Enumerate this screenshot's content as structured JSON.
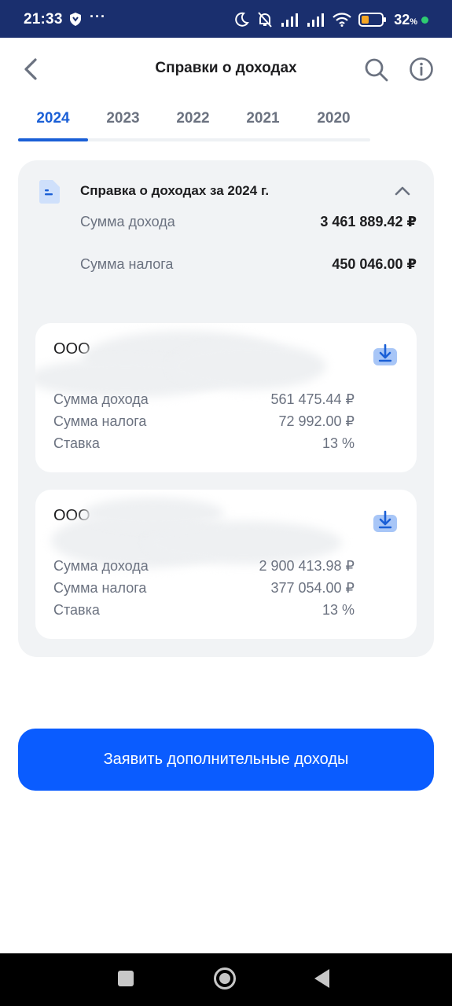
{
  "status_bar": {
    "time": "21:33",
    "dots": "···",
    "battery_percent": "32",
    "battery_unit": "%"
  },
  "header": {
    "title": "Справки о доходах",
    "back_icon": "chevron-left-icon",
    "search_icon": "search-icon",
    "info_icon": "info-icon"
  },
  "tabs": {
    "items": [
      {
        "label": "2024",
        "active": true
      },
      {
        "label": "2023",
        "active": false
      },
      {
        "label": "2022",
        "active": false
      },
      {
        "label": "2021",
        "active": false
      },
      {
        "label": "2020",
        "active": false
      }
    ]
  },
  "summary": {
    "title": "Справка о доходах за 2024 г.",
    "income_label": "Сумма дохода",
    "income_value": "3 461 889.42 ₽",
    "tax_label": "Сумма налога",
    "tax_value": "450 046.00 ₽"
  },
  "employers": [
    {
      "name": "ООО",
      "income_label": "Сумма дохода",
      "income_value": "561 475.44 ₽",
      "tax_label": "Сумма налога",
      "tax_value": "72 992.00 ₽",
      "rate_label": "Ставка",
      "rate_value": "13 %"
    },
    {
      "name": "ООО",
      "income_label": "Сумма дохода",
      "income_value": "2 900 413.98 ₽",
      "tax_label": "Сумма налога",
      "tax_value": "377 054.00 ₽",
      "rate_label": "Ставка",
      "rate_value": "13 %"
    }
  ],
  "primary_button": {
    "label": "Заявить дополнительные доходы"
  },
  "colors": {
    "accent": "#0a5cff",
    "tab_active": "#1a5fd6",
    "status_bar": "#1a2f6e",
    "card_bg": "#f1f3f5"
  }
}
